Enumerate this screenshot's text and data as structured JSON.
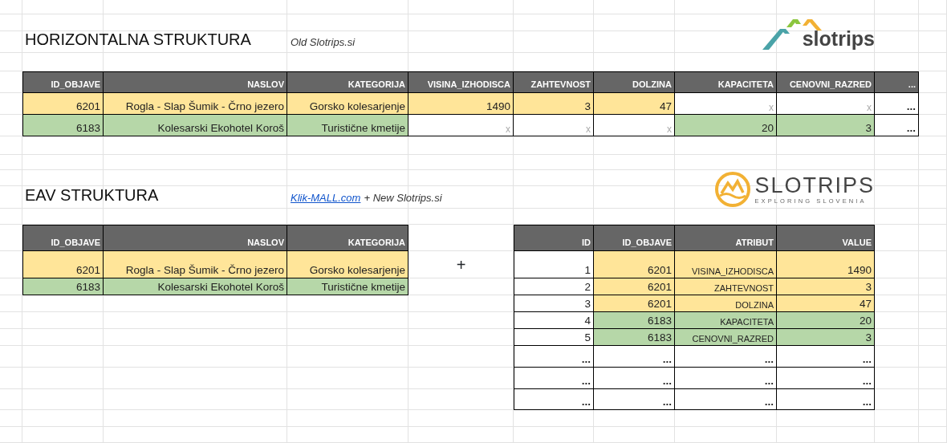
{
  "horizontal": {
    "title": "HORIZONTALNA STRUKTURA",
    "subtitle": "Old Slotrips.si",
    "logo": {
      "kind": "old",
      "text": "slotrips"
    },
    "table": {
      "columns": [
        "ID_OBJAVE",
        "NASLOV",
        "KATEGORIJA",
        "VISINA_IZHODISCA",
        "ZAHTEVNOST",
        "DOLZINA",
        "KAPACITETA",
        "CENOVNI_RAZRED",
        "..."
      ],
      "rows": [
        {
          "cells": [
            {
              "kind": "value",
              "text": "6201",
              "color": "#ffe599"
            },
            {
              "kind": "value",
              "text": "Rogla - Slap Šumik - Črno jezero",
              "color": "#ffe599"
            },
            {
              "kind": "value",
              "text": "Gorsko kolesarjenje",
              "color": "#ffe599"
            },
            {
              "kind": "value",
              "text": "1490",
              "color": "#ffe599"
            },
            {
              "kind": "value",
              "text": "3",
              "color": "#ffe599"
            },
            {
              "kind": "value",
              "text": "47",
              "color": "#ffe599"
            },
            {
              "kind": "blank",
              "text": "x"
            },
            {
              "kind": "blank",
              "text": "x"
            },
            {
              "kind": "more",
              "text": "..."
            }
          ]
        },
        {
          "cells": [
            {
              "kind": "value",
              "text": "6183",
              "color": "#b6d7a8"
            },
            {
              "kind": "value",
              "text": "Kolesarski Ekohotel Koroš",
              "color": "#b6d7a8"
            },
            {
              "kind": "value",
              "text": "Turistične kmetije",
              "color": "#b6d7a8"
            },
            {
              "kind": "blank",
              "text": "x"
            },
            {
              "kind": "blank",
              "text": "x"
            },
            {
              "kind": "blank",
              "text": "x"
            },
            {
              "kind": "value",
              "text": "20",
              "color": "#b6d7a8"
            },
            {
              "kind": "value",
              "text": "3",
              "color": "#b6d7a8"
            },
            {
              "kind": "more",
              "text": "..."
            }
          ]
        }
      ]
    }
  },
  "eav": {
    "title": "EAV STRUKTURA",
    "subtitle": {
      "link": "Klik-MALL.com",
      "text": "+ New Slotrips.si"
    },
    "logo": {
      "kind": "new",
      "text": "SLOTRIPS",
      "tagline": "EXPLORING SLOVENIA"
    },
    "entity_table": {
      "columns": [
        "ID_OBJAVE",
        "NASLOV",
        "KATEGORIJA"
      ],
      "rows": [
        {
          "cells": [
            {
              "kind": "value",
              "text": "6201",
              "color": "#ffe599"
            },
            {
              "kind": "value",
              "text": "Rogla - Slap Šumik - Črno jezero",
              "color": "#ffe599"
            },
            {
              "kind": "value",
              "text": "Gorsko kolesarjenje",
              "color": "#ffe599"
            }
          ]
        },
        {
          "cells": [
            {
              "kind": "value",
              "text": "6183",
              "color": "#b6d7a8"
            },
            {
              "kind": "value",
              "text": "Kolesarski Ekohotel Koroš",
              "color": "#b6d7a8"
            },
            {
              "kind": "value",
              "text": "Turistične kmetije",
              "color": "#b6d7a8"
            }
          ]
        }
      ]
    },
    "plus": "+",
    "attribute_table": {
      "columns": [
        "ID",
        "ID_OBJAVE",
        "ATRIBUT",
        "VALUE"
      ],
      "rows": [
        {
          "cells": [
            {
              "kind": "value",
              "text": "1"
            },
            {
              "kind": "value",
              "text": "6201",
              "color": "#ffe599"
            },
            {
              "kind": "attr",
              "text": "VISINA_IZHODISCA",
              "color": "#ffe599"
            },
            {
              "kind": "value",
              "text": "1490",
              "color": "#ffe599"
            }
          ]
        },
        {
          "cells": [
            {
              "kind": "value",
              "text": "2"
            },
            {
              "kind": "value",
              "text": "6201",
              "color": "#ffe599"
            },
            {
              "kind": "attr",
              "text": "ZAHTEVNOST",
              "color": "#ffe599"
            },
            {
              "kind": "value",
              "text": "3",
              "color": "#ffe599"
            }
          ]
        },
        {
          "cells": [
            {
              "kind": "value",
              "text": "3"
            },
            {
              "kind": "value",
              "text": "6201",
              "color": "#ffe599"
            },
            {
              "kind": "attr",
              "text": "DOLZINA",
              "color": "#ffe599"
            },
            {
              "kind": "value",
              "text": "47",
              "color": "#ffe599"
            }
          ]
        },
        {
          "cells": [
            {
              "kind": "value",
              "text": "4"
            },
            {
              "kind": "value",
              "text": "6183",
              "color": "#b6d7a8"
            },
            {
              "kind": "attr",
              "text": "KAPACITETA",
              "color": "#b6d7a8"
            },
            {
              "kind": "value",
              "text": "20",
              "color": "#b6d7a8"
            }
          ]
        },
        {
          "cells": [
            {
              "kind": "value",
              "text": "5"
            },
            {
              "kind": "value",
              "text": "6183",
              "color": "#b6d7a8"
            },
            {
              "kind": "attr",
              "text": "CENOVNI_RAZRED",
              "color": "#b6d7a8"
            },
            {
              "kind": "value",
              "text": "3",
              "color": "#b6d7a8"
            }
          ]
        },
        {
          "cells": [
            {
              "kind": "more",
              "text": "..."
            },
            {
              "kind": "more",
              "text": "..."
            },
            {
              "kind": "more",
              "text": "..."
            },
            {
              "kind": "more",
              "text": "..."
            }
          ]
        },
        {
          "cells": [
            {
              "kind": "more",
              "text": "..."
            },
            {
              "kind": "more",
              "text": "..."
            },
            {
              "kind": "more",
              "text": "..."
            },
            {
              "kind": "more",
              "text": "..."
            }
          ]
        },
        {
          "cells": [
            {
              "kind": "more",
              "text": "..."
            },
            {
              "kind": "more",
              "text": "..."
            },
            {
              "kind": "more",
              "text": "..."
            },
            {
              "kind": "more",
              "text": "..."
            }
          ]
        }
      ]
    }
  }
}
